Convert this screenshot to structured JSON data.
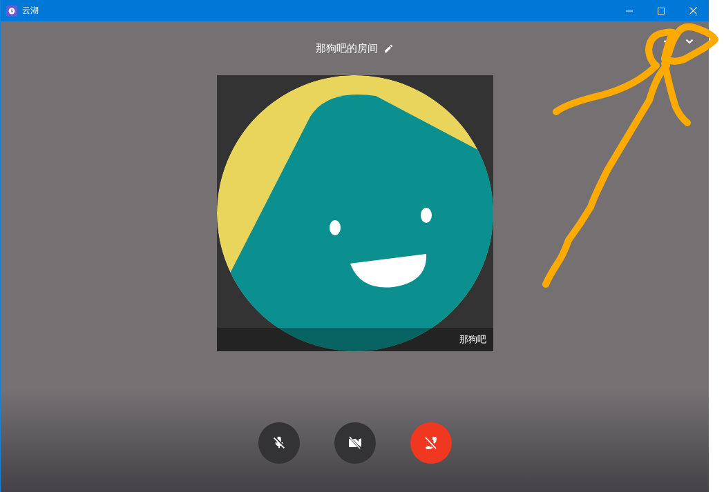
{
  "window": {
    "title": "云湖"
  },
  "room": {
    "title": "那狗吧的房间"
  },
  "tile": {
    "name": "那狗吧"
  },
  "controls": [
    {
      "kind": "mic"
    },
    {
      "kind": "camera"
    },
    {
      "kind": "hangup"
    }
  ]
}
